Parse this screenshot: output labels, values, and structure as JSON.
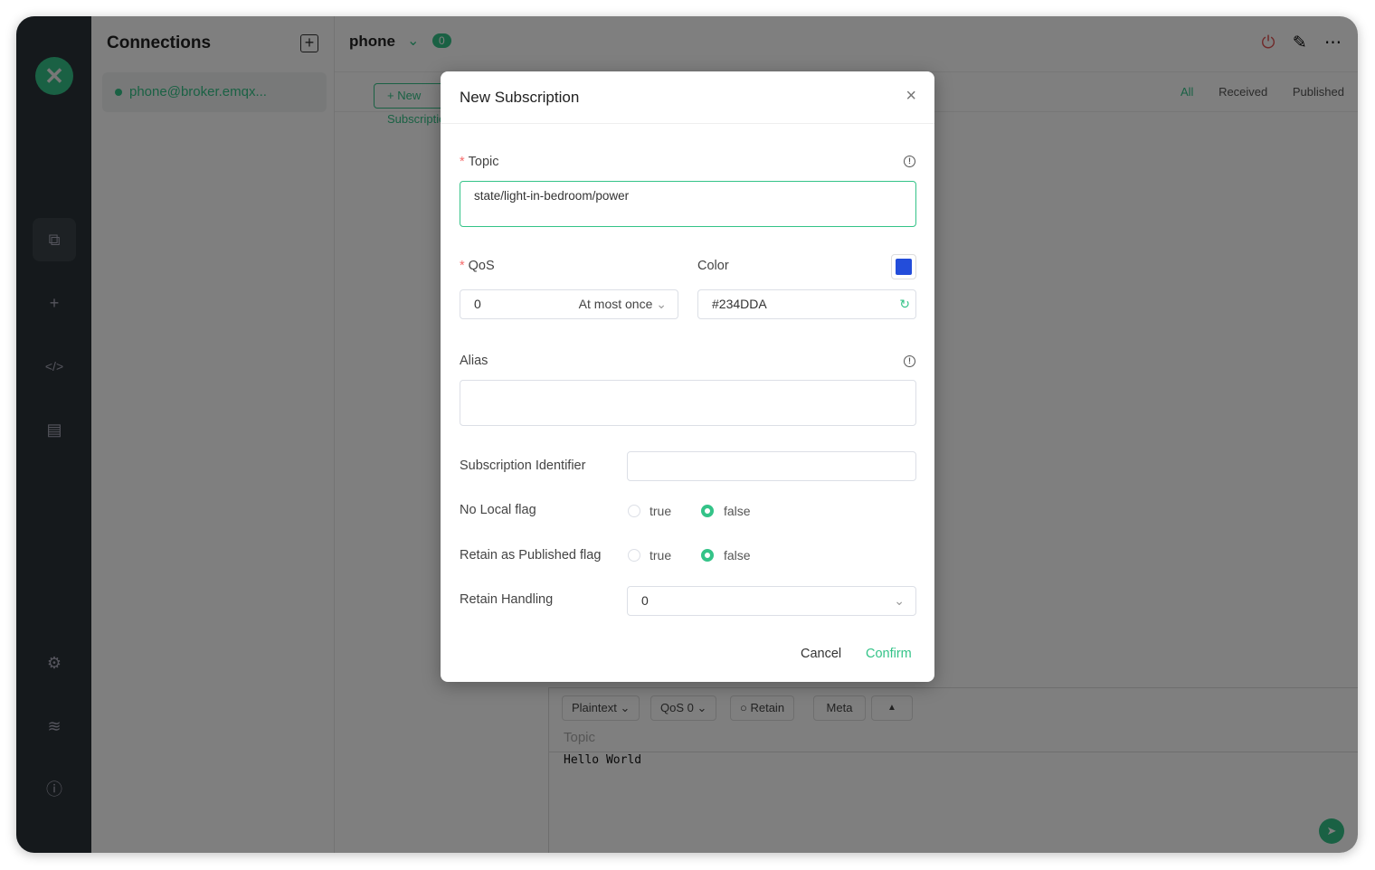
{
  "sidebar": {
    "logo": "emqx-x-logo",
    "items": [
      "connections-icon",
      "plus-icon",
      "code-icon",
      "log-icon",
      "settings-icon",
      "subscribe-feed-icon",
      "info-icon"
    ]
  },
  "connections": {
    "title": "Connections",
    "items": [
      {
        "label": "phone@broker.emqx...",
        "status": "connected"
      }
    ]
  },
  "header": {
    "title": "phone",
    "count": "0"
  },
  "toolbar": {
    "new_subscription": "New Subscription",
    "filters": [
      "All",
      "Received",
      "Published"
    ],
    "active_filter": "All"
  },
  "publish": {
    "format": "Plaintext",
    "qos": "QoS 0",
    "retain": "Retain",
    "meta": "Meta",
    "topic_placeholder": "Topic",
    "message": "Hello World"
  },
  "modal": {
    "title": "New Subscription",
    "topic_label": "Topic",
    "topic_value": "state/light-in-bedroom/power",
    "qos_label": "QoS",
    "qos_value": "0",
    "qos_desc": "At most once",
    "color_label": "Color",
    "color_value": "#234DDA",
    "alias_label": "Alias",
    "alias_value": "",
    "sub_id_label": "Subscription Identifier",
    "sub_id_value": "",
    "no_local_label": "No Local flag",
    "no_local": "false",
    "rap_label": "Retain as Published flag",
    "rap": "false",
    "true_label": "true",
    "false_label": "false",
    "retain_handling_label": "Retain Handling",
    "retain_handling_value": "0",
    "cancel": "Cancel",
    "confirm": "Confirm"
  },
  "colors": {
    "accent": "#34C388",
    "subscription_color": "#234DDA"
  }
}
